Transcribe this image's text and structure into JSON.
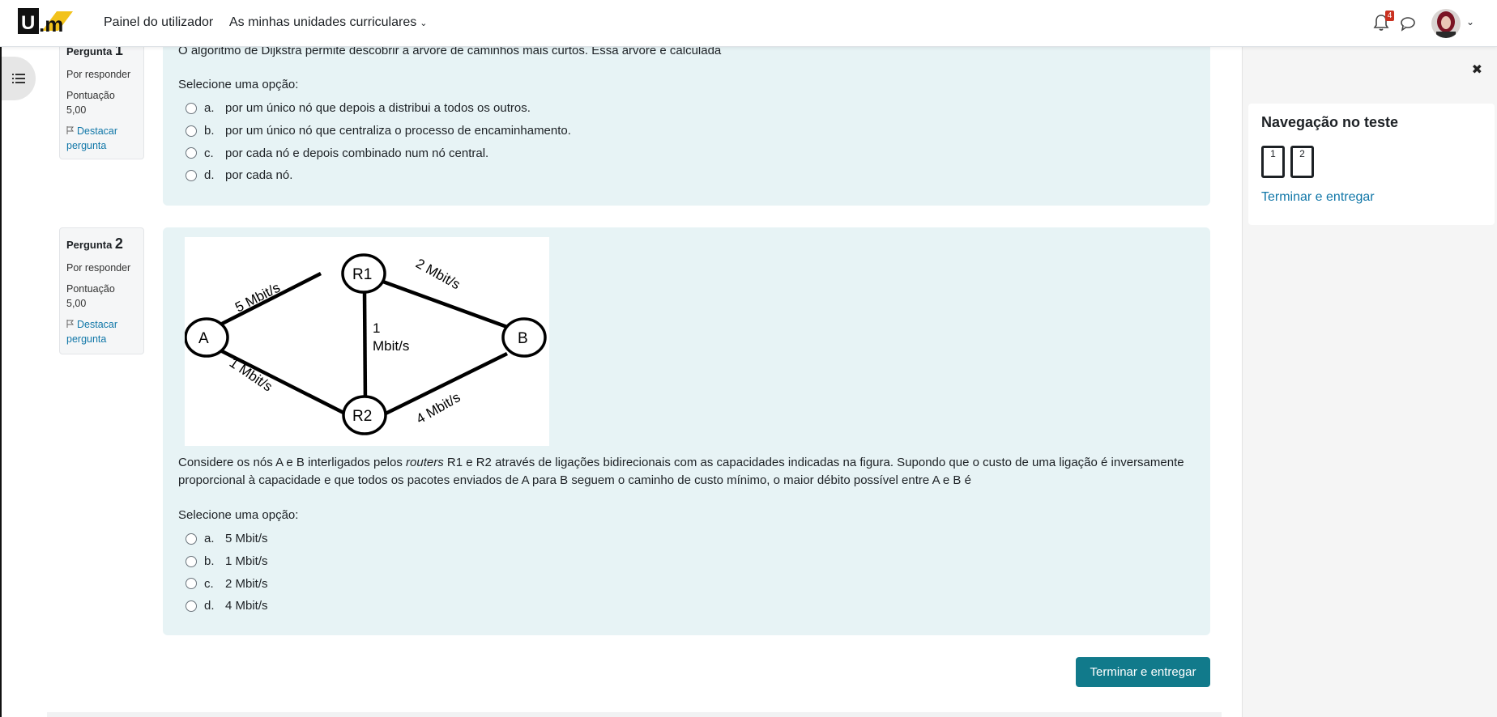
{
  "header": {
    "dashboard_label": "Painel do utilizador",
    "courses_label": "As minhas unidades curriculares",
    "notification_count": "4",
    "logo_text": "U.m"
  },
  "questions": [
    {
      "label": "Pergunta",
      "number": "1",
      "state": "Por responder",
      "grade_label": "Pontuação",
      "grade_value": "5,00",
      "flag_label": "Destacar pergunta",
      "text": "O algoritmo de Dijkstra permite descobrir a árvore de caminhos mais curtos. Essa árvore é calculada",
      "prompt": "Selecione uma opção:",
      "answers": [
        {
          "letter": "a.",
          "text": "por um único nó que depois a distribui a todos os outros."
        },
        {
          "letter": "b.",
          "text": "por um único nó que centraliza o processo de encaminhamento."
        },
        {
          "letter": "c.",
          "text": "por cada nó e depois combinado num nó central."
        },
        {
          "letter": "d.",
          "text": "por cada nó."
        }
      ]
    },
    {
      "label": "Pergunta",
      "number": "2",
      "state": "Por responder",
      "grade_label": "Pontuação",
      "grade_value": "5,00",
      "flag_label": "Destacar pergunta",
      "text_before": "Considere os nós A e B interligados pelos ",
      "text_em": "routers",
      "text_after": " R1 e R2 através de ligações bidirecionais com as capacidades indicadas na figura. Supondo que o custo de uma ligação é inversamente proporcional à capacidade e que todos os pacotes enviados de A para B seguem o caminho de custo mínimo, o maior débito possível entre A e B é",
      "prompt": "Selecione uma opção:",
      "answers": [
        {
          "letter": "a.",
          "text": "5 Mbit/s"
        },
        {
          "letter": "b.",
          "text": "1 Mbit/s"
        },
        {
          "letter": "c.",
          "text": "2 Mbit/s"
        },
        {
          "letter": "d.",
          "text": "4 Mbit/s"
        }
      ],
      "diagram": {
        "nodes": {
          "a": "A",
          "r1": "R1",
          "r2": "R2",
          "b": "B"
        },
        "links": {
          "a_r1": "5 Mbit/s",
          "r1_b": "2 Mbit/s",
          "r1_r2_line1": "1",
          "r1_r2_line2": "Mbit/s",
          "a_r2": "1 Mbit/s",
          "r2_b": "4 Mbit/s"
        }
      }
    }
  ],
  "footer": {
    "submit_label": "Terminar e entregar"
  },
  "drawer": {
    "close_glyph": "✖",
    "title": "Navegação no teste",
    "buttons": [
      "1",
      "2"
    ],
    "finish_link": "Terminar e entregar"
  },
  "colors": {
    "question_bg": "#e7f3f5",
    "accent": "#117a8b",
    "link": "#1177a8",
    "badge": "#ca3120"
  }
}
